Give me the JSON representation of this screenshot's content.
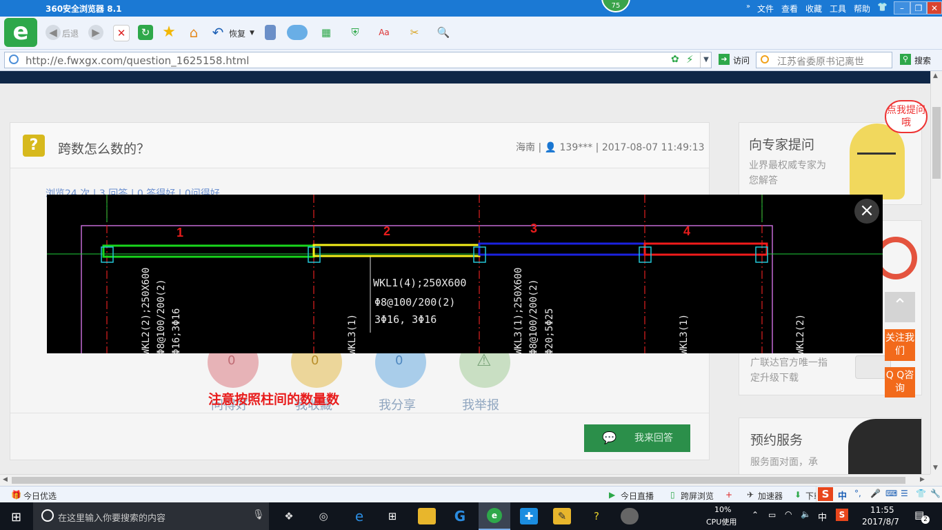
{
  "browser": {
    "title": "360安全浏览器 8.1",
    "badge": "75",
    "menu": [
      "文件",
      "查看",
      "收藏",
      "工具",
      "帮助"
    ],
    "back_label": "后退",
    "restore_label": "恢复",
    "url": "http://e.fwxgx.com/question_1625158.html",
    "visit_label": "访问",
    "search_placeholder": "江苏省委原书记离世",
    "search_label": "搜索"
  },
  "question": {
    "title": "跨数怎么数的？",
    "meta": "海南 | 👤 139*** | 2017-08-07 11:49:13",
    "stats": "浏览24 次 | 3 回答 | 0 答得好 | 0问得好",
    "actions": [
      {
        "count": "0",
        "label": "问得好",
        "color": "#e7b3b7"
      },
      {
        "count": "0",
        "label": "我收藏",
        "color": "#ecd69a"
      },
      {
        "count": "0",
        "label": "我分享",
        "color": "#a9cdea"
      },
      {
        "count": "",
        "label": "我举报",
        "color": "#c9dfc3"
      }
    ],
    "answer_button": "我来回答"
  },
  "sidebar": {
    "expert_title": "向专家提问",
    "expert_sub": "业界最权威专家为您解答",
    "bubble": "点我提问哦",
    "ad_text": "广联达官方唯一指定升级下载",
    "appointment_title": "预约服务",
    "appointment_sub": "服务面对面，承",
    "follow_label": "关注我们",
    "qq_label": "Q Q咨询"
  },
  "drawing": {
    "span_numbers": [
      "1",
      "2",
      "3",
      "4"
    ],
    "beam_note_1": "WKL1(4);250X600",
    "beam_note_2": "Φ8@100/200(2)",
    "beam_note_3": "3Φ16, 3Φ16",
    "vertical_labels": [
      "WKL2(2);250X600",
      "Φ8@100/200(2)",
      "Φ16;3Φ16",
      "WKL3(1)",
      "WKL3(1);250X600",
      "Φ8@100/200(2)",
      "Φ20;5Φ25",
      "WKL3(1)",
      "WKL2(2)"
    ],
    "caption": "注意按照柱间的数量数",
    "close_label": "×"
  },
  "statusbar": {
    "left": "今日优选",
    "live": "今日直播",
    "screen": "跨屏浏览",
    "accelerator": "加速器",
    "download": "下载"
  },
  "taskbar": {
    "search_placeholder": "在这里输入你要搜索的内容",
    "cpu_percent": "10%",
    "cpu_label": "CPU使用",
    "ime": "中",
    "time": "11:55",
    "date": "2017/8/7",
    "notifications": "2"
  },
  "colors": {
    "titlebar": "#1b79d4",
    "span1": "#19d61c",
    "span2": "#f7f21b",
    "span3": "#1b22e0",
    "span4": "#f21b1b",
    "accent_orange": "#f26a1b"
  }
}
